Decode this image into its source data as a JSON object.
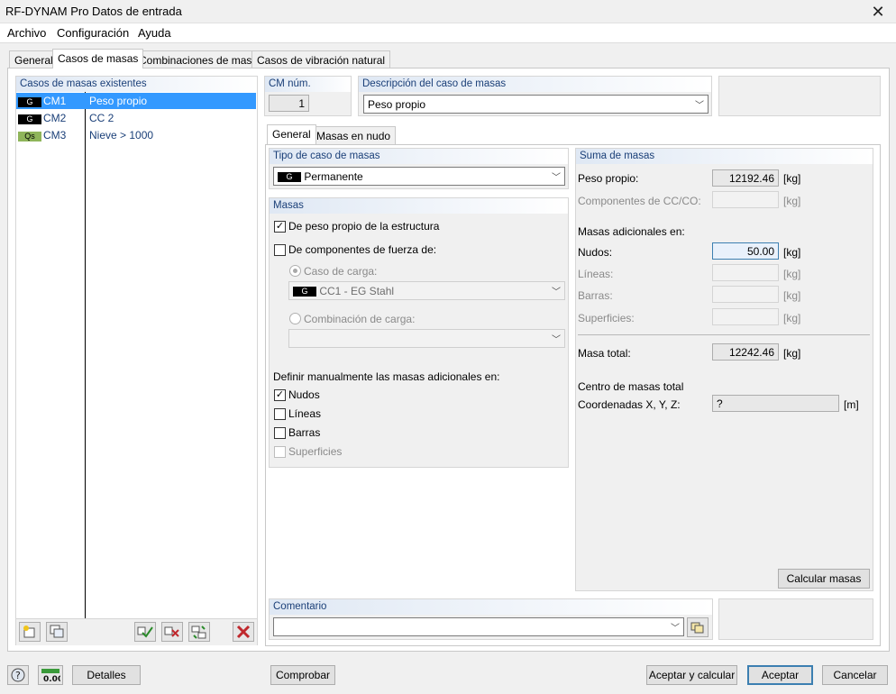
{
  "window": {
    "title": "RF-DYNAM Pro Datos de entrada"
  },
  "menu": [
    "Archivo",
    "Configuración",
    "Ayuda"
  ],
  "main_tabs": [
    "General",
    "Casos de masas",
    "Combinaciones de masas",
    "Casos de vibración natural"
  ],
  "mass_cases_list": {
    "header": "Casos de masas existentes",
    "items": [
      {
        "badge": "G",
        "id": "CM1",
        "name": "Peso propio",
        "selected": true
      },
      {
        "badge": "G",
        "id": "CM2",
        "name": "CC 2",
        "selected": false
      },
      {
        "badge": "Qs",
        "id": "CM3",
        "name": "Nieve > 1000",
        "selected": false
      }
    ]
  },
  "cm_num": {
    "header": "CM núm.",
    "value": "1"
  },
  "description": {
    "header": "Descripción del caso de masas",
    "value": "Peso propio"
  },
  "sub_tabs": [
    "General",
    "Masas en nudo"
  ],
  "tipo": {
    "header": "Tipo de caso de masas",
    "badge": "G",
    "value": "Permanente"
  },
  "masas": {
    "header": "Masas",
    "peso_propio": "De peso propio de la estructura",
    "componentes": "De componentes de fuerza de:",
    "caso_carga": "Caso de carga:",
    "caso_carga_badge": "G",
    "caso_carga_value": "CC1 - EG Stahl",
    "combinacion": "Combinación de carga:",
    "definir": "Definir manualmente las masas adicionales en:",
    "nudos": "Nudos",
    "lineas": "Líneas",
    "barras": "Barras",
    "superficies": "Superficies"
  },
  "suma": {
    "header": "Suma de masas",
    "peso_propio_label": "Peso propio:",
    "peso_propio_value": "12192.46",
    "componentes_label": "Componentes de CC/CO:",
    "adicionales_label": "Masas adicionales en:",
    "nudos_label": "Nudos:",
    "nudos_value": "50.00",
    "lineas_label": "Líneas:",
    "barras_label": "Barras:",
    "superficies_label": "Superficies:",
    "total_label": "Masa total:",
    "total_value": "12242.46",
    "centro_label": "Centro de masas total",
    "coord_label": "Coordenadas X, Y, Z:",
    "coord_value": "?",
    "unit_kg": "[kg]",
    "unit_m": "[m]",
    "calc_button": "Calcular masas"
  },
  "comentario": {
    "header": "Comentario",
    "value": ""
  },
  "footer": {
    "detalles": "Detalles",
    "comprobar": "Comprobar",
    "aceptar_calcular": "Aceptar y calcular",
    "aceptar": "Aceptar",
    "cancelar": "Cancelar",
    "units_icon_text": "0.00"
  }
}
